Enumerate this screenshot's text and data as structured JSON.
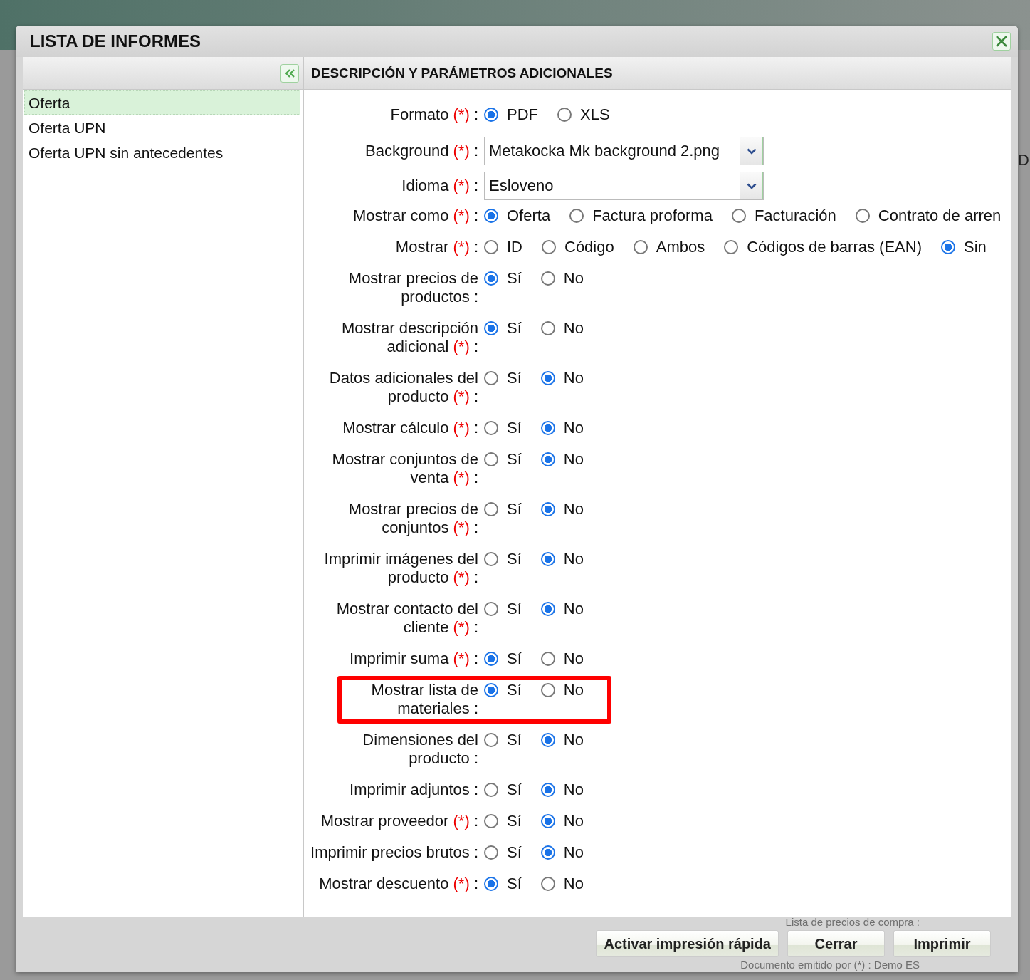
{
  "window": {
    "title": "LISTA DE INFORMES"
  },
  "report_list": {
    "items": [
      {
        "label": "Oferta",
        "selected": true
      },
      {
        "label": "Oferta UPN",
        "selected": false
      },
      {
        "label": "Oferta UPN sin antecedentes",
        "selected": false
      }
    ]
  },
  "parameters": {
    "title": "DESCRIPCIÓN Y PARÁMETROS ADICIONALES",
    "rows": [
      {
        "kind": "radio",
        "label": "Formato",
        "required_mark": "(*)",
        "colon": ":",
        "highlighted": false,
        "options": [
          {
            "label": "PDF",
            "selected": true
          },
          {
            "label": "XLS",
            "selected": false
          }
        ]
      },
      {
        "kind": "select",
        "label": "Background",
        "required_mark": "(*)",
        "colon": ":",
        "highlighted": false,
        "value": "Metakocka Mk background 2.png"
      },
      {
        "kind": "select",
        "label": "Idioma",
        "required_mark": "(*)",
        "colon": ":",
        "highlighted": false,
        "value": "Esloveno"
      },
      {
        "kind": "radio",
        "label": "Mostrar como",
        "required_mark": "(*)",
        "colon": ":",
        "highlighted": false,
        "options": [
          {
            "label": "Oferta",
            "selected": true
          },
          {
            "label": "Factura proforma",
            "selected": false
          },
          {
            "label": "Facturación",
            "selected": false
          },
          {
            "label": "Contrato de arren",
            "selected": false
          }
        ]
      },
      {
        "kind": "radio",
        "label": "Mostrar",
        "required_mark": "(*)",
        "colon": ":",
        "highlighted": false,
        "options": [
          {
            "label": "ID",
            "selected": false
          },
          {
            "label": "Código",
            "selected": false
          },
          {
            "label": "Ambos",
            "selected": false
          },
          {
            "label": "Códigos de barras (EAN)",
            "selected": false
          },
          {
            "label": "Sin",
            "selected": true
          }
        ]
      },
      {
        "kind": "radio",
        "label": "Mostrar precios de productos",
        "colon": ":",
        "highlighted": false,
        "options": [
          {
            "label": "Sí",
            "selected": true
          },
          {
            "label": "No",
            "selected": false
          }
        ]
      },
      {
        "kind": "radio",
        "label": "Mostrar descripción adicional",
        "required_mark": "(*)",
        "colon": ":",
        "highlighted": false,
        "options": [
          {
            "label": "Sí",
            "selected": true
          },
          {
            "label": "No",
            "selected": false
          }
        ]
      },
      {
        "kind": "radio",
        "label": "Datos adicionales del producto",
        "required_mark": "(*)",
        "colon": ":",
        "highlighted": false,
        "options": [
          {
            "label": "Sí",
            "selected": false
          },
          {
            "label": "No",
            "selected": true
          }
        ]
      },
      {
        "kind": "radio",
        "label": "Mostrar cálculo",
        "required_mark": "(*)",
        "colon": ":",
        "highlighted": false,
        "options": [
          {
            "label": "Sí",
            "selected": false
          },
          {
            "label": "No",
            "selected": true
          }
        ]
      },
      {
        "kind": "radio",
        "label": "Mostrar conjuntos de venta",
        "required_mark": "(*)",
        "colon": ":",
        "highlighted": false,
        "options": [
          {
            "label": "Sí",
            "selected": false
          },
          {
            "label": "No",
            "selected": true
          }
        ]
      },
      {
        "kind": "radio",
        "label": "Mostrar precios de conjuntos",
        "required_mark": "(*)",
        "colon": ":",
        "highlighted": false,
        "options": [
          {
            "label": "Sí",
            "selected": false
          },
          {
            "label": "No",
            "selected": true
          }
        ]
      },
      {
        "kind": "radio",
        "label": "Imprimir imágenes del producto",
        "required_mark": "(*)",
        "colon": ":",
        "highlighted": false,
        "options": [
          {
            "label": "Sí",
            "selected": false
          },
          {
            "label": "No",
            "selected": true
          }
        ]
      },
      {
        "kind": "radio",
        "label": "Mostrar contacto del cliente",
        "required_mark": "(*)",
        "colon": ":",
        "highlighted": false,
        "options": [
          {
            "label": "Sí",
            "selected": false
          },
          {
            "label": "No",
            "selected": true
          }
        ]
      },
      {
        "kind": "radio",
        "label": "Imprimir suma",
        "required_mark": "(*)",
        "colon": ":",
        "highlighted": false,
        "options": [
          {
            "label": "Sí",
            "selected": true
          },
          {
            "label": "No",
            "selected": false
          }
        ]
      },
      {
        "kind": "radio",
        "label": "Mostrar lista de materiales",
        "colon": ":",
        "highlighted": true,
        "options": [
          {
            "label": "Sí",
            "selected": true
          },
          {
            "label": "No",
            "selected": false
          }
        ]
      },
      {
        "kind": "radio",
        "label": "Dimensiones del producto",
        "colon": ":",
        "highlighted": false,
        "options": [
          {
            "label": "Sí",
            "selected": false
          },
          {
            "label": "No",
            "selected": true
          }
        ]
      },
      {
        "kind": "radio",
        "label": "Imprimir adjuntos",
        "colon": ":",
        "highlighted": false,
        "options": [
          {
            "label": "Sí",
            "selected": false
          },
          {
            "label": "No",
            "selected": true
          }
        ]
      },
      {
        "kind": "radio",
        "label": "Mostrar proveedor",
        "required_mark": "(*)",
        "colon": ":",
        "highlighted": false,
        "options": [
          {
            "label": "Sí",
            "selected": false
          },
          {
            "label": "No",
            "selected": true
          }
        ]
      },
      {
        "kind": "radio",
        "label": "Imprimir precios brutos",
        "colon": ":",
        "highlighted": false,
        "options": [
          {
            "label": "Sí",
            "selected": false
          },
          {
            "label": "No",
            "selected": true
          }
        ]
      },
      {
        "kind": "radio",
        "label": "Mostrar descuento",
        "required_mark": "(*)",
        "colon": ":",
        "highlighted": false,
        "options": [
          {
            "label": "Sí",
            "selected": true
          },
          {
            "label": "No",
            "selected": false
          }
        ]
      }
    ]
  },
  "buttons": [
    "Activar impresión rápida",
    "Cerrar",
    "Imprimir"
  ],
  "background_texts": {
    "side": "D",
    "top": "Lista de precios de compra :",
    "bottom": {
      "label": "Documento emitido por",
      "required_mark": "(*)",
      "colon": ":",
      "value": "Demo ES"
    }
  }
}
